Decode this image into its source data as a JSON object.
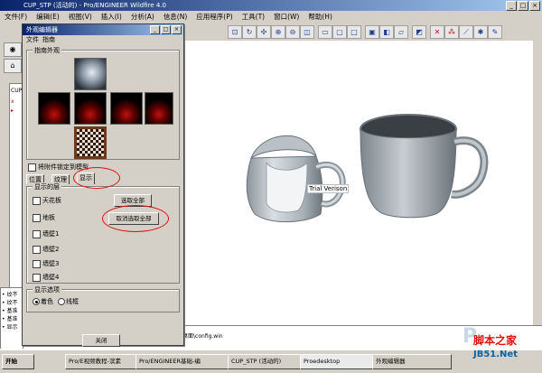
{
  "app": {
    "title": "CUP_STP (活动的) - Pro/ENGINEER Wildfire 4.0",
    "menus": [
      "文件(F)",
      "编辑(E)",
      "视图(V)",
      "插入(I)",
      "分析(A)",
      "信息(N)",
      "应用程序(P)",
      "工具(T)",
      "窗口(W)",
      "帮助(H)"
    ],
    "window_controls": [
      "_",
      "□",
      "×"
    ]
  },
  "tree": {
    "items": [
      "CUP",
      "x",
      "▸"
    ]
  },
  "messages": {
    "lines": [
      "• 纹不",
      "• 纹不",
      "• 基准",
      "• 基准",
      "• 显示"
    ]
  },
  "dialog": {
    "title": "外观编辑器",
    "menus": [
      "文件",
      "指南"
    ],
    "appearance_group": "指南外观",
    "checkbox_bind": "将附件锁定到模型",
    "tabs": [
      "位置",
      "纹理",
      "显示"
    ],
    "active_tab": "显示",
    "display_group": "显示的层",
    "layers": [
      "天花板",
      "地板",
      "墙壁1",
      "墙壁2",
      "墙壁3",
      "墙壁4"
    ],
    "select_all": "选取全部",
    "deselect_all": "取消选取全部",
    "display_options_group": "显示选项",
    "radio_options": [
      "着色",
      "线框"
    ],
    "radio_selected": "着色",
    "close_button": "关闭"
  },
  "viewport": {
    "label": "Trial Verison"
  },
  "statusbar": {
    "path": "\\桌面\\config.win"
  },
  "taskbar": {
    "start": "开始",
    "buttons": [
      "Pro/E视频教程-滨素",
      "Pro/ENGINEER基础-编",
      "CUP_STP (活动的)",
      "Proedesktop",
      "外观编辑器"
    ]
  },
  "watermark": {
    "line1": "脚本之家",
    "line2": "JB51.Net"
  },
  "colors": {
    "title_start": "#0a246a",
    "title_end": "#a6caf0",
    "annotation_red": "#e01010"
  }
}
